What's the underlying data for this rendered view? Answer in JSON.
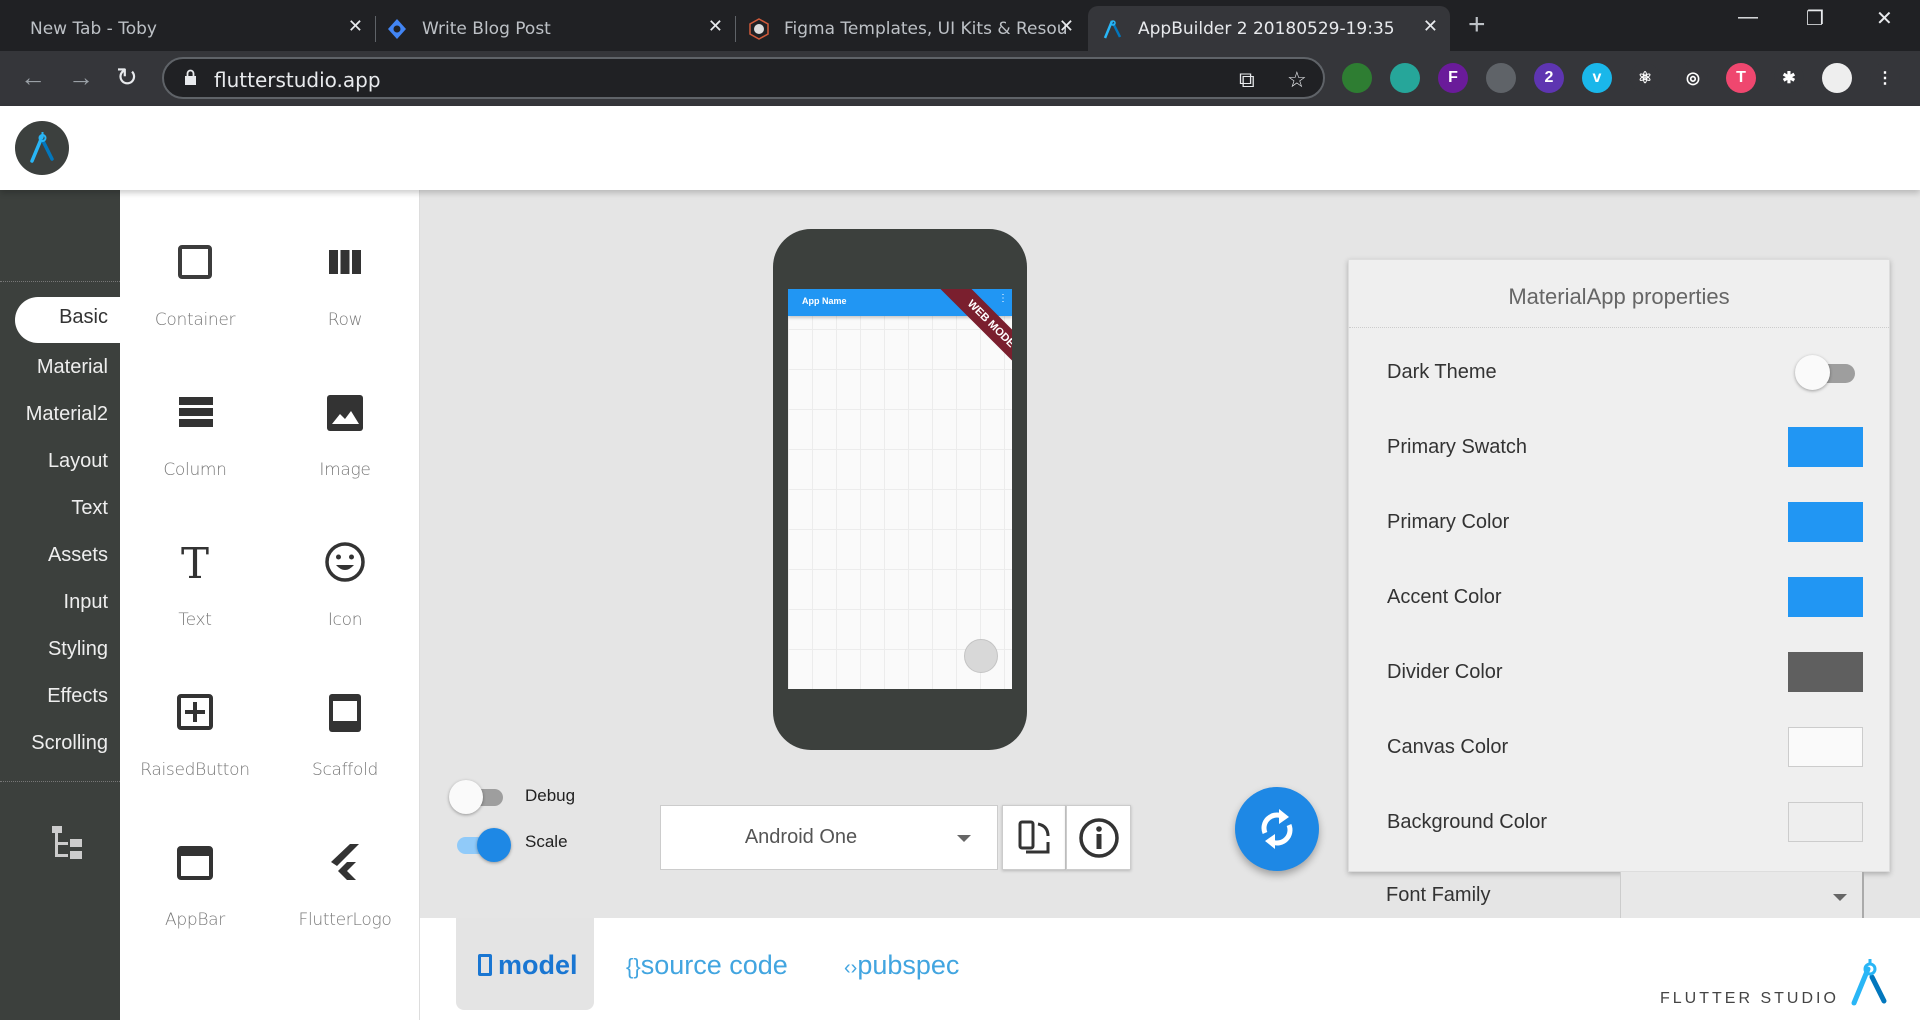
{
  "browser": {
    "tabs": [
      {
        "title": "New Tab - Toby",
        "icon": "none",
        "active": false
      },
      {
        "title": "Write Blog Post",
        "icon": "blue-diamond-icon",
        "active": false
      },
      {
        "title": "Figma Templates, UI Kits & Resou",
        "icon": "figma-templates-icon",
        "active": false
      },
      {
        "title": "AppBuilder 2 20180529-19:35",
        "icon": "flutter-studio-compass-icon",
        "active": true
      }
    ],
    "close_glyph": "✕",
    "new_tab_glyph": "+",
    "window_controls": {
      "minimize": "—",
      "restore": "❐",
      "close": "✕"
    },
    "url": "flutterstudio.app",
    "extensions": [
      {
        "name": "pen-extension",
        "badge": ""
      },
      {
        "name": "bitmoji-extension",
        "badge": ""
      },
      {
        "name": "f-extension",
        "badge": "F"
      },
      {
        "name": "chrome-apps-extension",
        "badge": ""
      },
      {
        "name": "stack-extension",
        "badge": "2"
      },
      {
        "name": "vimeo-extension",
        "badge": "v"
      },
      {
        "name": "react-extension",
        "badge": "⚛"
      },
      {
        "name": "target-extension",
        "badge": "◎"
      },
      {
        "name": "toby-extension",
        "badge": "T"
      },
      {
        "name": "puzzle-extensions",
        "badge": "✱"
      },
      {
        "name": "profile-avatar",
        "badge": ""
      },
      {
        "name": "menu",
        "badge": "⋮"
      }
    ]
  },
  "nav": {
    "items": [
      "Basic",
      "Material",
      "Material2",
      "Layout",
      "Text",
      "Assets",
      "Input",
      "Styling",
      "Effects",
      "Scrolling"
    ],
    "active": "Basic"
  },
  "palette": {
    "widgets": [
      "Container",
      "Row",
      "Column",
      "Image",
      "Text",
      "Icon",
      "RaisedButton",
      "Scaffold",
      "AppBar",
      "FlutterLogo"
    ]
  },
  "phone": {
    "app_title": "App Name",
    "ribbon": "WEB MODE",
    "menu_glyph": "⋮"
  },
  "controls": {
    "debug": {
      "label": "Debug",
      "on": false
    },
    "scale": {
      "label": "Scale",
      "on": true
    },
    "device": "Android One"
  },
  "properties": {
    "title": "MaterialApp properties",
    "dark_theme": {
      "label": "Dark Theme",
      "on": false
    },
    "colors": [
      {
        "label": "Primary Swatch",
        "color": "#2196f3"
      },
      {
        "label": "Primary Color",
        "color": "#2196f3"
      },
      {
        "label": "Accent Color",
        "color": "#2196f3"
      },
      {
        "label": "Divider Color",
        "color": "#5f5f5f"
      },
      {
        "label": "Canvas Color",
        "color": "#fafafa"
      },
      {
        "label": "Background Color",
        "color": "#eeeeee"
      }
    ],
    "font_family": {
      "label": "Font Family",
      "value": ""
    }
  },
  "bottom_tabs": [
    {
      "icon": "▯",
      "label": "model",
      "active": true
    },
    {
      "icon": "{}",
      "label": "source code",
      "active": false
    },
    {
      "icon": "‹›",
      "label": "pubspec",
      "active": false
    }
  ],
  "brand": "FLUTTER STUDIO",
  "theme": {
    "accent": "#2196f3",
    "fab": "#1e88e5",
    "nav_bg": "#3c403d",
    "tab_link": "#42a5e0"
  }
}
